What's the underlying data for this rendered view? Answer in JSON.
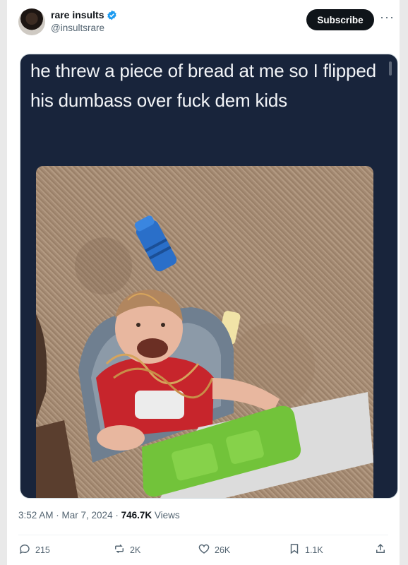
{
  "author": {
    "display_name": "rare insults",
    "handle": "@insultsrare",
    "verified_icon": "verified-badge-icon",
    "badge_color": "#1d9bf0"
  },
  "header": {
    "subscribe_label": "Subscribe",
    "more_label": "···"
  },
  "post": {
    "meme_text": "he threw a piece of bread at me so I flipped his dumbass over fuck dem kids",
    "image_icon": "photo-of-toddler-flipped-in-high-chair"
  },
  "meta": {
    "time": "3:52 AM",
    "sep1": " · ",
    "date": "Mar 7, 2024",
    "sep2": " · ",
    "views_count": "746.7K",
    "views_label": " Views"
  },
  "actions": {
    "replies": "215",
    "reposts": "2K",
    "likes": "26K",
    "bookmarks": "1.1K"
  },
  "colors": {
    "text_primary": "#0f1419",
    "text_secondary": "#536471",
    "meme_bg": "#18243b",
    "button_bg": "#0f1419"
  }
}
